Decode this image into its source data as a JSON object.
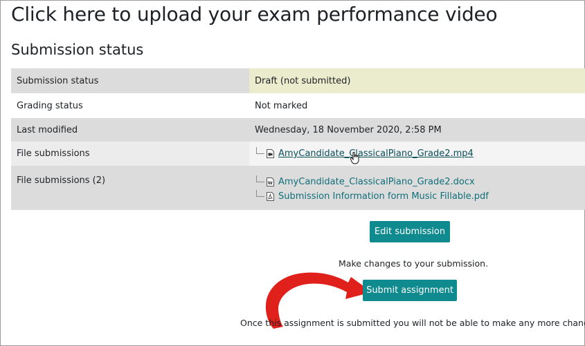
{
  "page": {
    "title": "Click here to upload your exam performance video",
    "section_title": "Submission status"
  },
  "table": {
    "rows": [
      {
        "label": "Submission status",
        "value": "Draft (not submitted)"
      },
      {
        "label": "Grading status",
        "value": "Not marked"
      },
      {
        "label": "Last modified",
        "value": "Wednesday, 18 November 2020, 2:58 PM"
      },
      {
        "label": "File submissions",
        "files": [
          {
            "name": "AmyCandidate_ClassicalPiano_Grade2.mp4",
            "icon": "video-file-icon"
          }
        ]
      },
      {
        "label": "File submissions (2)",
        "files": [
          {
            "name": "AmyCandidate_ClassicalPiano_Grade2.docx",
            "icon": "word-file-icon"
          },
          {
            "name": "Submission Information form Music Fillable.pdf",
            "icon": "pdf-file-icon"
          }
        ]
      }
    ]
  },
  "actions": {
    "edit_label": "Edit submission",
    "edit_help": "Make changes to your submission.",
    "submit_label": "Submit assignment",
    "submit_help": "Once this assignment is submitted you will not be able to make any more changes."
  },
  "colors": {
    "button": "#0f8a8e",
    "link": "#0f6e7a",
    "draft_highlight": "#eaeccd",
    "annotation_arrow": "#e0201b"
  }
}
